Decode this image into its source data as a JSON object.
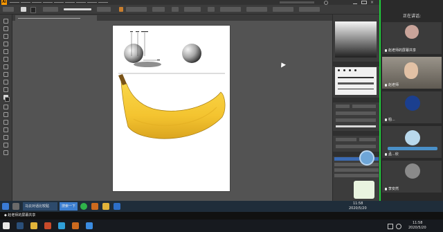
{
  "app": {
    "logo": "Ai"
  },
  "meeting": {
    "header": "正在讲话:",
    "participants": [
      {
        "name": "赵老师的屏幕共享"
      },
      {
        "name": "赵老师"
      },
      {
        "name": "柏..."
      },
      {
        "name": "孟...欣"
      },
      {
        "name": "李安然"
      }
    ]
  },
  "taskbar": {
    "app_label": "马云对话比较贴",
    "search_text": "搜索一下",
    "time": "11:58",
    "date": "2020/5/20"
  },
  "bottombar": {
    "share_label": "◆ 赵老师的屏幕共享",
    "time": "11:58",
    "date": "2020/5/20"
  },
  "colors": {
    "accent": "#1fcf3b",
    "banana": "#f4c430",
    "taskbar": "#1f2d3a"
  }
}
